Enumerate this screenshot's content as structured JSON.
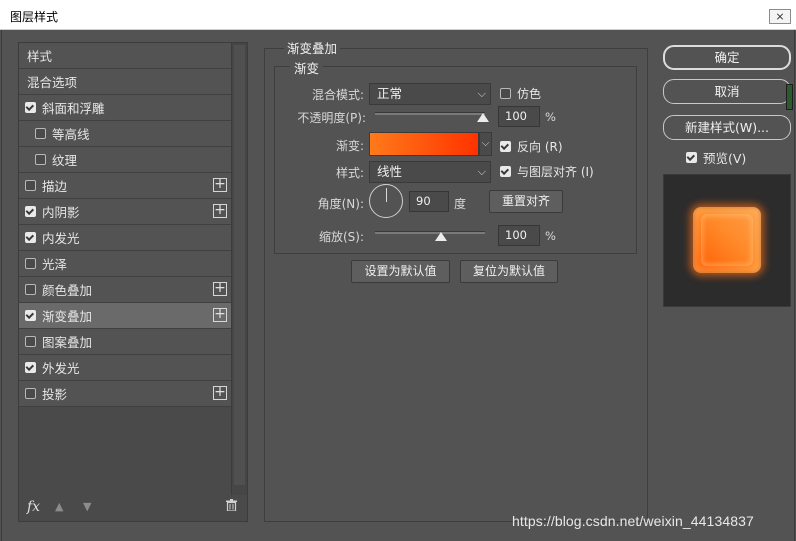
{
  "window": {
    "title": "图层样式",
    "close_glyph": "⨯"
  },
  "left_list": {
    "items": [
      {
        "label": "样式",
        "checkbox": false,
        "checked": false,
        "plus": false,
        "indent": false,
        "selected": false
      },
      {
        "label": "混合选项",
        "checkbox": false,
        "checked": false,
        "plus": false,
        "indent": false,
        "selected": false
      },
      {
        "label": "斜面和浮雕",
        "checkbox": true,
        "checked": true,
        "plus": false,
        "indent": false,
        "selected": false
      },
      {
        "label": "等高线",
        "checkbox": true,
        "checked": false,
        "plus": false,
        "indent": true,
        "selected": false
      },
      {
        "label": "纹理",
        "checkbox": true,
        "checked": false,
        "plus": false,
        "indent": true,
        "selected": false
      },
      {
        "label": "描边",
        "checkbox": true,
        "checked": false,
        "plus": true,
        "indent": false,
        "selected": false
      },
      {
        "label": "内阴影",
        "checkbox": true,
        "checked": true,
        "plus": true,
        "indent": false,
        "selected": false
      },
      {
        "label": "内发光",
        "checkbox": true,
        "checked": true,
        "plus": false,
        "indent": false,
        "selected": false
      },
      {
        "label": "光泽",
        "checkbox": true,
        "checked": false,
        "plus": false,
        "indent": false,
        "selected": false
      },
      {
        "label": "颜色叠加",
        "checkbox": true,
        "checked": false,
        "plus": true,
        "indent": false,
        "selected": false
      },
      {
        "label": "渐变叠加",
        "checkbox": true,
        "checked": true,
        "plus": true,
        "indent": false,
        "selected": true
      },
      {
        "label": "图案叠加",
        "checkbox": true,
        "checked": false,
        "plus": false,
        "indent": false,
        "selected": false
      },
      {
        "label": "外发光",
        "checkbox": true,
        "checked": true,
        "plus": false,
        "indent": false,
        "selected": false
      },
      {
        "label": "投影",
        "checkbox": true,
        "checked": false,
        "plus": true,
        "indent": false,
        "selected": false
      }
    ],
    "footer": {
      "fx": "fx",
      "up_icon": "arrow-up-icon",
      "down_icon": "arrow-down-icon",
      "trash_icon": "trash-icon"
    }
  },
  "gradient_overlay": {
    "group_title": "渐变叠加",
    "sub_title": "渐变",
    "blend_mode_label": "混合模式:",
    "blend_mode_value": "正常",
    "dither_label": "仿色",
    "dither_checked": false,
    "opacity_label": "不透明度(P):",
    "opacity_value": "100",
    "opacity_fraction": 1.0,
    "percent": "%",
    "gradient_label": "渐变:",
    "gradient_colors": [
      "#ff7a1a",
      "#ff3300"
    ],
    "reverse_label": "反向 (R)",
    "reverse_checked": true,
    "style_label": "样式:",
    "style_value": "线性",
    "align_label": "与图层对齐 (I)",
    "align_checked": true,
    "angle_label": "角度(N):",
    "angle_value": "90",
    "angle_unit": "度",
    "reset_align_label": "重置对齐",
    "scale_label": "缩放(S):",
    "scale_value": "100",
    "scale_fraction": 0.5,
    "set_default_label": "设置为默认值",
    "reset_default_label": "复位为默认值"
  },
  "right_panel": {
    "ok_label": "确定",
    "cancel_label": "取消",
    "new_style_label": "新建样式(W)...",
    "preview_label": "预览(V)",
    "preview_checked": true
  },
  "watermark": "https://blog.csdn.net/weixin_44134837"
}
